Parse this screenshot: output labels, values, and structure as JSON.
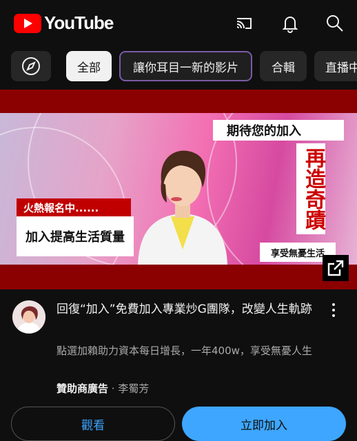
{
  "header": {
    "brand": "YouTube",
    "icons": [
      "cast-icon",
      "bell-icon",
      "search-icon"
    ]
  },
  "chips": [
    {
      "label": "全部",
      "active": true
    },
    {
      "label": "讓你耳目一新的影片",
      "active": false
    },
    {
      "label": "合輯",
      "active": false
    },
    {
      "label": "直播中",
      "active": false
    }
  ],
  "ad": {
    "banner_top": "期待您的加入",
    "vertical_text": "再造奇蹟",
    "hot_label": "火熱報名中......",
    "box_text": "加入提高生活質量",
    "enjoy_text": "享受無憂生活",
    "title": "回復“加入”免費加入專業炒G團隊，改變人生軌跡",
    "description": "點選加賴助力資本每日增長，一年400w，享受無憂人生",
    "sponsored_label": "贊助商廣告",
    "separator": " · ",
    "advertiser": "李蜀芳",
    "watch_label": "觀看",
    "join_label": "立即加入"
  },
  "colors": {
    "background": "#0f0f0f",
    "accent_blue": "#3ea6ff",
    "brand_red": "#ff0000"
  }
}
